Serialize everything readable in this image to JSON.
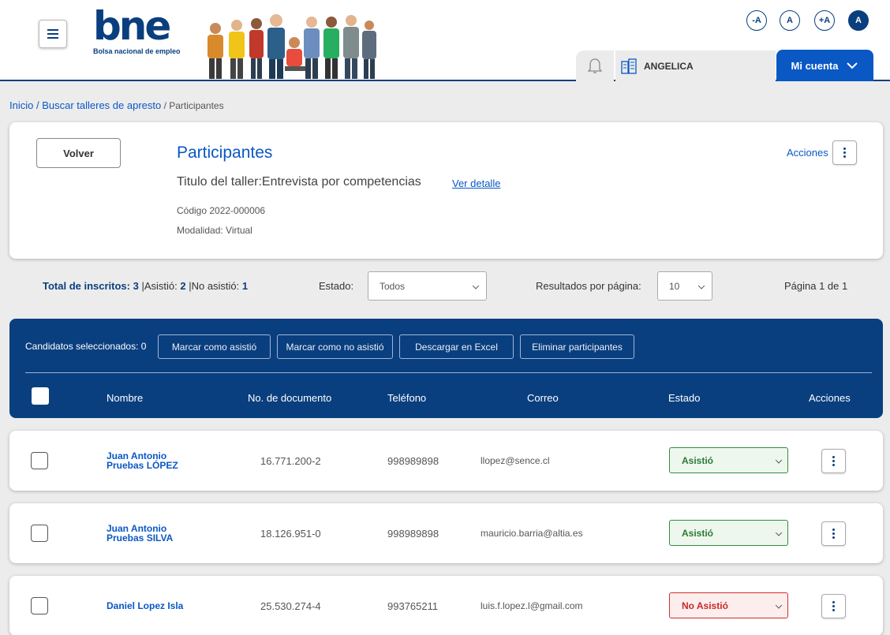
{
  "header": {
    "logo_text": "bne",
    "logo_subtitle": "Bolsa nacional de empleo",
    "accessibility": [
      "-A",
      "A",
      "+A",
      "A"
    ],
    "user_name": "ANGELICA",
    "account_label": "Mi cuenta"
  },
  "breadcrumb": {
    "home": "Inicio",
    "sep": " / ",
    "search": "Buscar talleres de apresto",
    "current": " / Participantes"
  },
  "card": {
    "back_label": "Volver",
    "title": "Participantes",
    "taller": "Titulo del taller:Entrevista por competencias",
    "ver_detalle": "Ver detalle",
    "codigo": "Código 2022-000006",
    "modalidad": "Modalidad: Virtual",
    "acciones": "Acciones"
  },
  "stats": {
    "total_label": "Total de inscritos: ",
    "total_value": "3",
    "asistio_label": " |Asistió: ",
    "asistio_value": "2",
    "no_asistio_label": " |No asistió: ",
    "no_asistio_value": "1",
    "estado_label": "Estado:",
    "estado_value": "Todos",
    "resultados_label": "Resultados por página:",
    "resultados_value": "10",
    "pagina": "Página 1 de 1"
  },
  "table": {
    "selected_label": "Candidatos seleccionados:  0",
    "buttons": [
      "Marcar como asistió",
      "Marcar como no asistió",
      "Descargar en Excel",
      "Eliminar participantes"
    ],
    "columns": [
      "Nombre",
      "No. de documento",
      "Teléfono",
      "Correo",
      "Estado",
      "Acciones"
    ],
    "rows": [
      {
        "name1": "Juan Antonio",
        "name2": "Pruebas LÓPEZ",
        "doc": "16.771.200-2",
        "tel": "998989898",
        "mail": "llopez@sence.cl",
        "estado": "Asistió",
        "status_color": "#2a7a33"
      },
      {
        "name1": "Juan Antonio",
        "name2": "Pruebas SILVA",
        "doc": "18.126.951-0",
        "tel": "998989898",
        "mail": "mauricio.barria@altia.es",
        "estado": "Asistió",
        "status_color": "#2a7a33"
      },
      {
        "name1": "Daniel Lopez Isla",
        "name2": "",
        "doc": "25.530.274-4",
        "tel": "993765211",
        "mail": "luis.f.lopez.l@gmail.com",
        "estado": "No Asistió",
        "status_color": "#c82828"
      }
    ]
  },
  "colors": {
    "primary": "#0a3f7f",
    "accent": "#0a58c4",
    "danger": "#e6282f"
  }
}
